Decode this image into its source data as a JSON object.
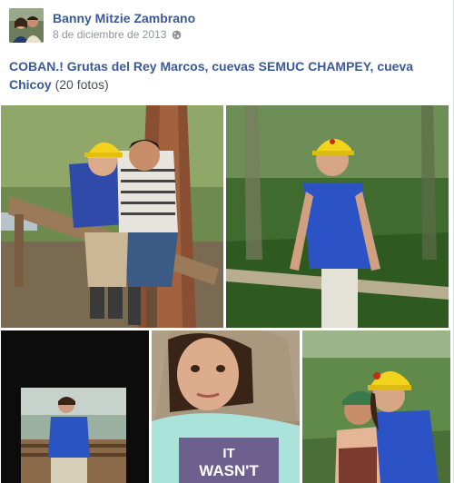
{
  "post": {
    "author": "Banny Mitzie Zambrano",
    "date": "8 de diciembre de 2013",
    "privacy_icon": "globe-icon",
    "album_title": "COBAN.! Grutas del Rey Marcos, cuevas SEMUC CHAMPEY, cueva Chicoy",
    "photo_count": "(20 fotos)",
    "photo_text": "IT WASN'T"
  },
  "colors": {
    "link": "#3b5998",
    "meta": "#90949c"
  }
}
